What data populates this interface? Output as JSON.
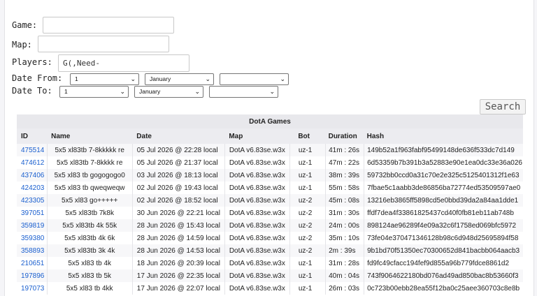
{
  "form": {
    "game_label": "Game:",
    "game_value": "",
    "map_label": "Map:",
    "map_value": "",
    "players_label": "Players:",
    "players_value": "G(,Need-",
    "date_from_label": "Date From:",
    "date_to_label": "To:",
    "date_from": {
      "day": "1",
      "month": "January",
      "year": ""
    },
    "date_to": {
      "day": "1",
      "month": "January",
      "year": ""
    },
    "search_label": "Search"
  },
  "table": {
    "caption": "DotA Games",
    "headers": [
      "ID",
      "Name",
      "Date",
      "Map",
      "Bot",
      "Duration",
      "Hash"
    ],
    "rows": [
      [
        "475514",
        "5x5 xl83tb 7-8kkkkk re",
        "05 Jul 2026 @ 22:28 local",
        "DotA v6.83se.w3x",
        "uz-1",
        "41m : 26s",
        "149b52a1f963fabf95499148de636f533dc7d149"
      ],
      [
        "474612",
        "5x5 xl83tb 7-8kkkk re",
        "05 Jul 2026 @ 21:37 local",
        "DotA v6.83se.w3x",
        "uz-1",
        "47m : 22s",
        "6d53359b7b391b3a52883e90e1ea0dc33e36a026"
      ],
      [
        "437406",
        "5x5 xl83 tb gogogogo0",
        "03 Jul 2026 @ 18:13 local",
        "DotA v6.83se.w3x",
        "uz-1",
        "38m : 39s",
        "59732bb0ccd0a31c70e2e325c5125401312f1e63"
      ],
      [
        "424203",
        "5x5 xl83 tb qweqweqw",
        "02 Jul 2026 @ 19:43 local",
        "DotA v6.83se.w3x",
        "uz-1",
        "55m : 58s",
        "7fbae5c1aabb3de86856ba72774ed53509597ae0"
      ],
      [
        "423305",
        "5x5 xl83 go+++++",
        "02 Jul 2026 @ 18:52 local",
        "DotA v6.83se.w3x",
        "uz-2",
        "45m : 08s",
        "13216eb3865ff5898cd5e0bbd39da2a84aa1dde1"
      ],
      [
        "397051",
        "5x5 xl83tb 7k8k",
        "30 Jun 2026 @ 22:21 local",
        "DotA v6.83se.w3x",
        "uz-2",
        "31m : 30s",
        "ffdf7dea4f33861825437cd40f0fb81eb11ab748b"
      ],
      [
        "359819",
        "5x5 xl83tb 4k 55k",
        "28 Jun 2026 @ 15:43 local",
        "DotA v6.83se.w3x",
        "uz-2",
        "24m : 00s",
        "898124ae96289f4e09a32c6f1758ed069bfc5972"
      ],
      [
        "359380",
        "5x5 xl83tb 4k 6k",
        "28 Jun 2026 @ 14:59 local",
        "DotA v6.83se.w3x",
        "uz-2",
        "35m : 10s",
        "73fe04e370471346128b98c6d948d25695894f58"
      ],
      [
        "358893",
        "5x5 xl83tb 3k 4k",
        "28 Jun 2026 @ 14:53 local",
        "DotA v6.83se.w3x",
        "uz-2",
        "2m : 39s",
        "9b1bd70f51350ec70300652d841bacbb064aacb3"
      ],
      [
        "210651",
        "5x5 xl83 tb 4k",
        "18 Jun 2026 @ 20:39 local",
        "DotA v6.83se.w3x",
        "uz-1",
        "31m : 28s",
        "fd9fc49cfacc194fef9d855a96b779fdce8861d2"
      ],
      [
        "197896",
        "5x5 xl83 tb 5k",
        "17 Jun 2026 @ 22:35 local",
        "DotA v6.83se.w3x",
        "uz-1",
        "40m : 04s",
        "743f9064622180bd076ad49ad850bac8b53660f3"
      ],
      [
        "197073",
        "5x5 xl83 tb 4kk",
        "17 Jun 2026 @ 22:07 local",
        "DotA v6.83se.w3x",
        "uz-1",
        "26m : 03s",
        "0c723b00ebb28ea55f12ba0c25aee360703c8e8b"
      ]
    ]
  }
}
